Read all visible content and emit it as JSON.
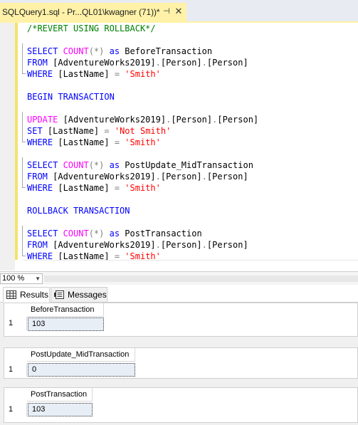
{
  "tab": {
    "title": "SQLQuery1.sql - Pr...QL01\\kwagner (71))*",
    "pin_glyph": "⊣",
    "close_glyph": "✕"
  },
  "editor": {
    "lines": [
      [
        {
          "t": "/*REVERT USING ROLLBACK*/",
          "c": "cm"
        }
      ],
      [],
      [
        {
          "t": "SELECT ",
          "c": "kw"
        },
        {
          "t": "COUNT",
          "c": "fn"
        },
        {
          "t": "(*)",
          "c": "gr"
        },
        {
          "t": " as ",
          "c": "kw"
        },
        {
          "t": "BeforeTransaction",
          "c": ""
        }
      ],
      [
        {
          "t": "FROM ",
          "c": "kw"
        },
        {
          "t": "[AdventureWorks2019]",
          "c": ""
        },
        {
          "t": ".",
          "c": "gr"
        },
        {
          "t": "[Person]",
          "c": ""
        },
        {
          "t": ".",
          "c": "gr"
        },
        {
          "t": "[Person]",
          "c": ""
        }
      ],
      [
        {
          "t": "WHERE ",
          "c": "kw"
        },
        {
          "t": "[LastName] ",
          "c": ""
        },
        {
          "t": "= ",
          "c": "gr"
        },
        {
          "t": "'Smith'",
          "c": "str"
        }
      ],
      [],
      [
        {
          "t": "BEGIN TRANSACTION",
          "c": "kw"
        }
      ],
      [],
      [
        {
          "t": "UPDATE ",
          "c": "fn"
        },
        {
          "t": "[AdventureWorks2019]",
          "c": ""
        },
        {
          "t": ".",
          "c": "gr"
        },
        {
          "t": "[Person]",
          "c": ""
        },
        {
          "t": ".",
          "c": "gr"
        },
        {
          "t": "[Person]",
          "c": ""
        }
      ],
      [
        {
          "t": "SET ",
          "c": "kw"
        },
        {
          "t": "[LastName] ",
          "c": ""
        },
        {
          "t": "= ",
          "c": "gr"
        },
        {
          "t": "'Not Smith'",
          "c": "str"
        }
      ],
      [
        {
          "t": "WHERE ",
          "c": "kw"
        },
        {
          "t": "[LastName] ",
          "c": ""
        },
        {
          "t": "= ",
          "c": "gr"
        },
        {
          "t": "'Smith'",
          "c": "str"
        }
      ],
      [],
      [
        {
          "t": "SELECT ",
          "c": "kw"
        },
        {
          "t": "COUNT",
          "c": "fn"
        },
        {
          "t": "(*)",
          "c": "gr"
        },
        {
          "t": " as ",
          "c": "kw"
        },
        {
          "t": "PostUpdate_MidTransaction",
          "c": ""
        }
      ],
      [
        {
          "t": "FROM ",
          "c": "kw"
        },
        {
          "t": "[AdventureWorks2019]",
          "c": ""
        },
        {
          "t": ".",
          "c": "gr"
        },
        {
          "t": "[Person]",
          "c": ""
        },
        {
          "t": ".",
          "c": "gr"
        },
        {
          "t": "[Person]",
          "c": ""
        }
      ],
      [
        {
          "t": "WHERE ",
          "c": "kw"
        },
        {
          "t": "[LastName] ",
          "c": ""
        },
        {
          "t": "= ",
          "c": "gr"
        },
        {
          "t": "'Smith'",
          "c": "str"
        }
      ],
      [],
      [
        {
          "t": "ROLLBACK TRANSACTION",
          "c": "kw"
        }
      ],
      [],
      [
        {
          "t": "SELECT ",
          "c": "kw"
        },
        {
          "t": "COUNT",
          "c": "fn"
        },
        {
          "t": "(*)",
          "c": "gr"
        },
        {
          "t": " as ",
          "c": "kw"
        },
        {
          "t": "PostTransaction",
          "c": ""
        }
      ],
      [
        {
          "t": "FROM ",
          "c": "kw"
        },
        {
          "t": "[AdventureWorks2019]",
          "c": ""
        },
        {
          "t": ".",
          "c": "gr"
        },
        {
          "t": "[Person]",
          "c": ""
        },
        {
          "t": ".",
          "c": "gr"
        },
        {
          "t": "[Person]",
          "c": ""
        }
      ],
      [
        {
          "t": "WHERE ",
          "c": "kw"
        },
        {
          "t": "[LastName] ",
          "c": ""
        },
        {
          "t": "= ",
          "c": "gr"
        },
        {
          "t": "'Smith'",
          "c": "str"
        }
      ]
    ]
  },
  "zoom": {
    "value": "100 %"
  },
  "results_tabs": {
    "results": "Results",
    "messages": "Messages"
  },
  "grids": [
    {
      "column": "BeforeTransaction",
      "row_number": "1",
      "value": "103"
    },
    {
      "column": "PostUpdate_MidTransaction",
      "row_number": "1",
      "value": "0"
    },
    {
      "column": "PostTransaction",
      "row_number": "1",
      "value": "103"
    }
  ],
  "colors": {
    "tab_active": "#fff2a8",
    "keyword": "#0000ff",
    "function": "#ff00ff",
    "string": "#ff0000",
    "comment": "#008000"
  }
}
